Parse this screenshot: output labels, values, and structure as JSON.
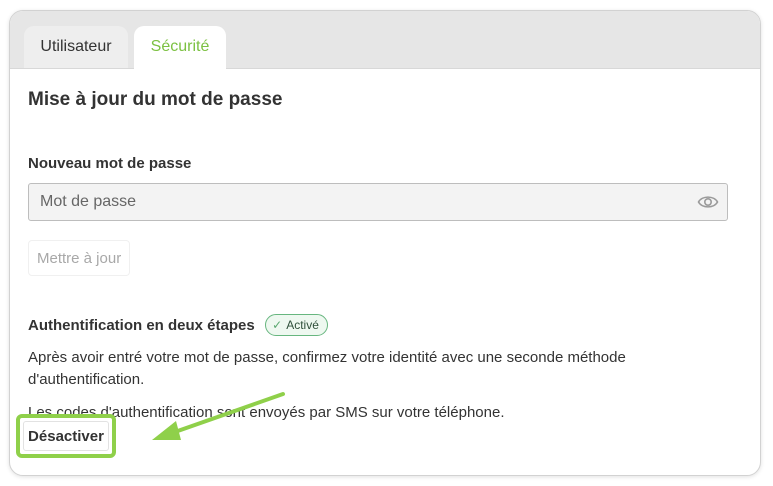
{
  "tabs": [
    {
      "label": "Utilisateur",
      "active": false
    },
    {
      "label": "Sécurité",
      "active": true
    }
  ],
  "password_section": {
    "title": "Mise à jour du mot de passe",
    "field_label": "Nouveau mot de passe",
    "placeholder": "Mot de passe",
    "value": "",
    "toggle_icon": "eye-icon",
    "update_button": "Mettre à jour"
  },
  "two_factor": {
    "label": "Authentification en deux étapes",
    "status_badge": "Activé",
    "status_icon": "check-icon",
    "description": "Après avoir entré votre mot de passe, confirmez votre identité avec une seconde méthode d'authentification.",
    "sms_note": "Les codes d'authentification sont envoyés par SMS sur votre téléphone.",
    "deactivate_button": "Désactiver"
  },
  "colors": {
    "accent": "#7cc142",
    "highlight": "#8fd04a",
    "badge_border": "#67b67f"
  }
}
